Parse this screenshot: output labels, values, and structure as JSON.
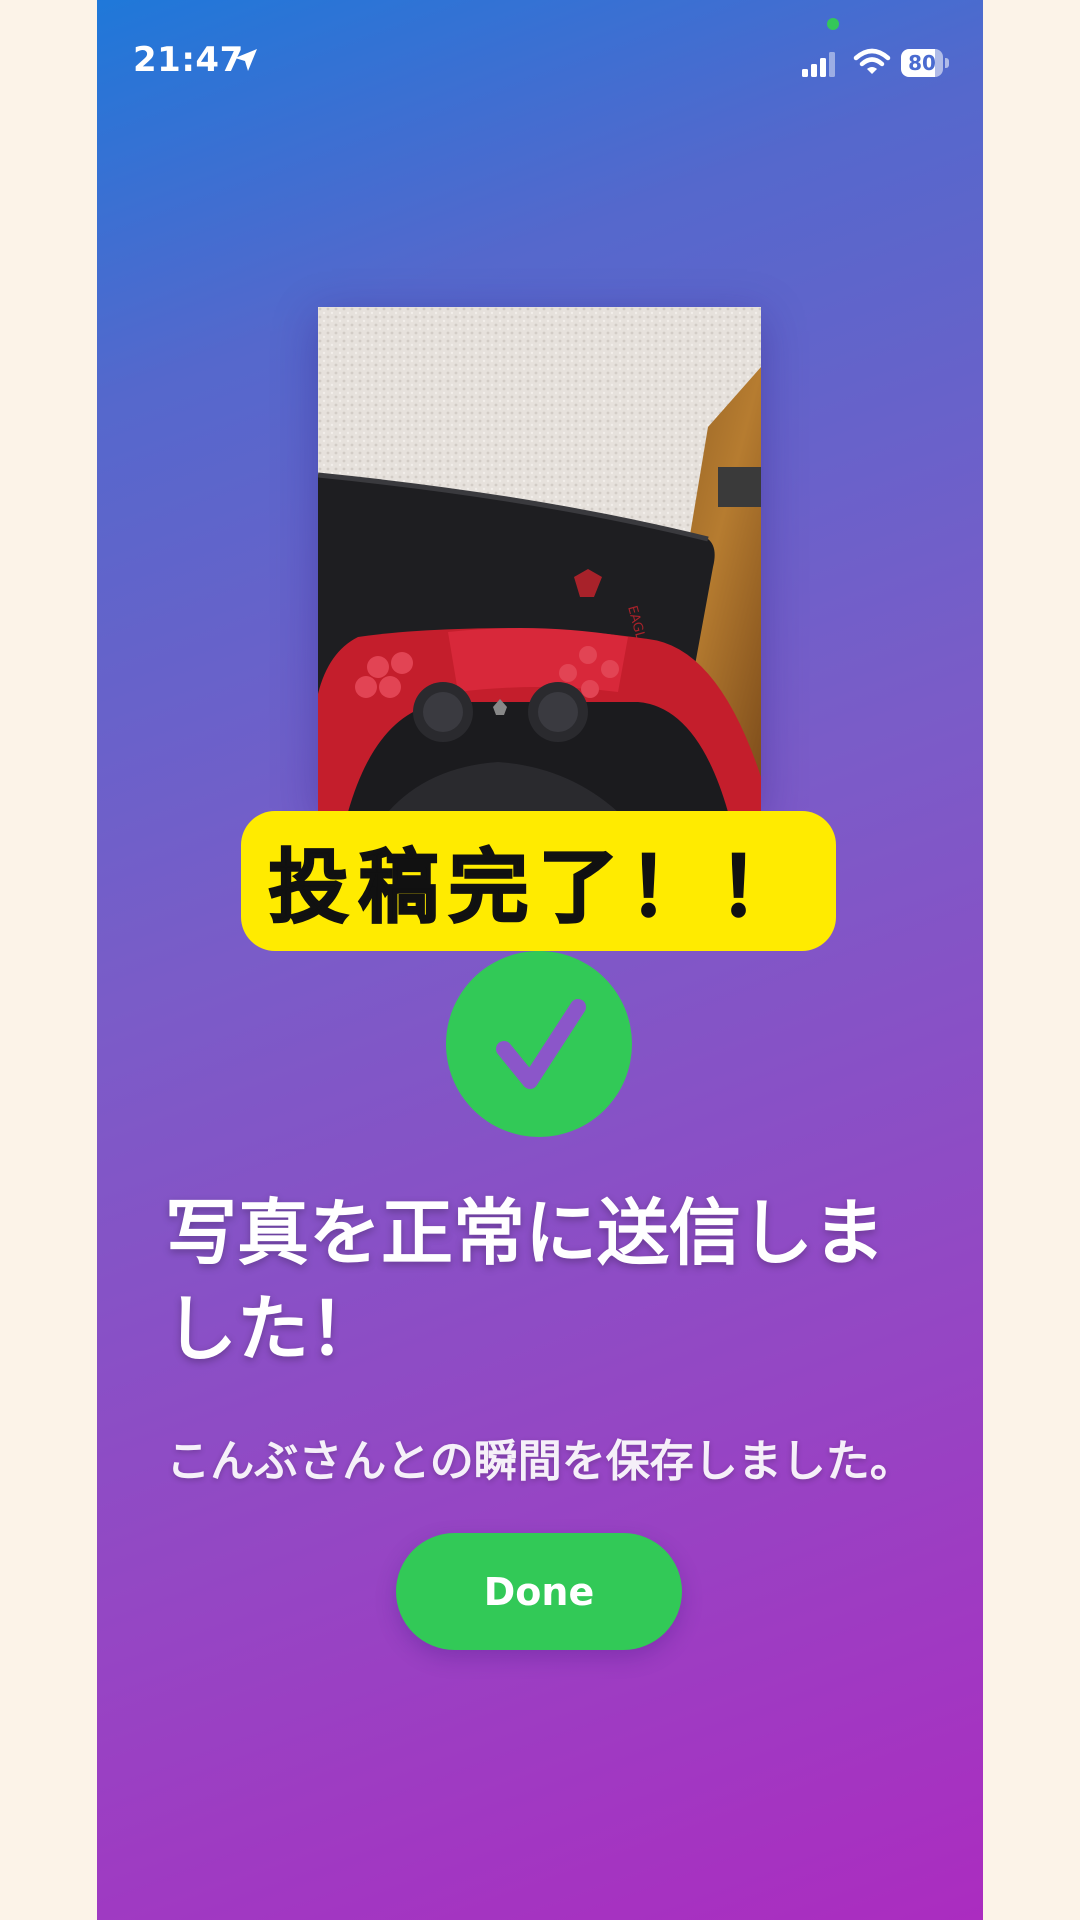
{
  "status_bar": {
    "time": "21:47",
    "battery_level": "80",
    "icons": [
      "location-arrow-icon",
      "cellular-signal-icon",
      "wifi-icon",
      "battery-charging-icon"
    ]
  },
  "banner": {
    "text": "投稿完了！！"
  },
  "success": {
    "icon": "checkmark-icon",
    "title": "写真を正常に送信しました！",
    "message": "こんぶさんとの瞬間を保存しました。"
  },
  "actions": {
    "done_label": "Done"
  },
  "colors": {
    "gradient_top": "#1f78d9",
    "gradient_bottom": "#ab2cc0",
    "banner_yellow": "#ffeb00",
    "success_green": "#32c957"
  }
}
